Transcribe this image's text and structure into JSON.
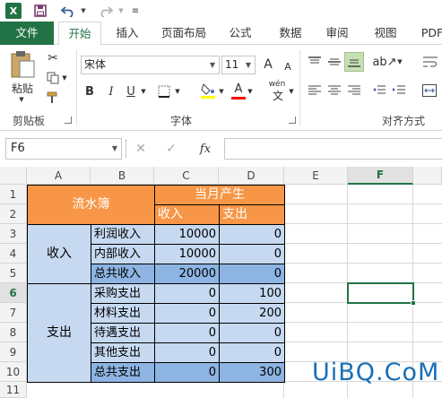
{
  "colors": {
    "excel_green": "#217346",
    "header_orange": "#f79646",
    "cell_blue": "#c6d9f1",
    "total_blue": "#8db4e2"
  },
  "qat": {
    "logo": "X"
  },
  "tabs": [
    "文件",
    "开始",
    "插入",
    "页面布局",
    "公式",
    "数据",
    "审阅",
    "视图",
    "PDF"
  ],
  "ribbon": {
    "paste_label": "粘贴",
    "clipboard_label": "剪贴板",
    "font_label": "字体",
    "alignment_label": "对齐方式",
    "font_name": "宋体",
    "font_size": "11",
    "bold": "B",
    "italic": "I",
    "underline": "U",
    "grow_font": "A",
    "shrink_font": "A",
    "font_color": "A",
    "phonetic": "wén"
  },
  "formula_bar": {
    "name_box": "F6",
    "fx": "fx",
    "formula": ""
  },
  "grid": {
    "columns": [
      "A",
      "B",
      "C",
      "D",
      "E",
      "F"
    ],
    "rows": [
      "1",
      "2",
      "3",
      "4",
      "5",
      "6",
      "7",
      "8",
      "9",
      "10",
      "11"
    ],
    "selected_col": "F",
    "selected_row": "6"
  },
  "table": {
    "title": "流水簿",
    "period_header": "当月产生",
    "income_header": "收入",
    "expense_header": "支出",
    "group_income": "收入",
    "group_expense": "支出",
    "rows": [
      {
        "label": "利润收入",
        "income": "10000",
        "expense": "0"
      },
      {
        "label": "内部收入",
        "income": "10000",
        "expense": "0"
      },
      {
        "label": "总共收入",
        "income": "20000",
        "expense": "0"
      },
      {
        "label": "采购支出",
        "income": "0",
        "expense": "100"
      },
      {
        "label": "材料支出",
        "income": "0",
        "expense": "200"
      },
      {
        "label": "待遇支出",
        "income": "0",
        "expense": "0"
      },
      {
        "label": "其他支出",
        "income": "0",
        "expense": "0"
      },
      {
        "label": "总共支出",
        "income": "0",
        "expense": "300"
      }
    ]
  },
  "watermark": "UiBQ.CoM"
}
